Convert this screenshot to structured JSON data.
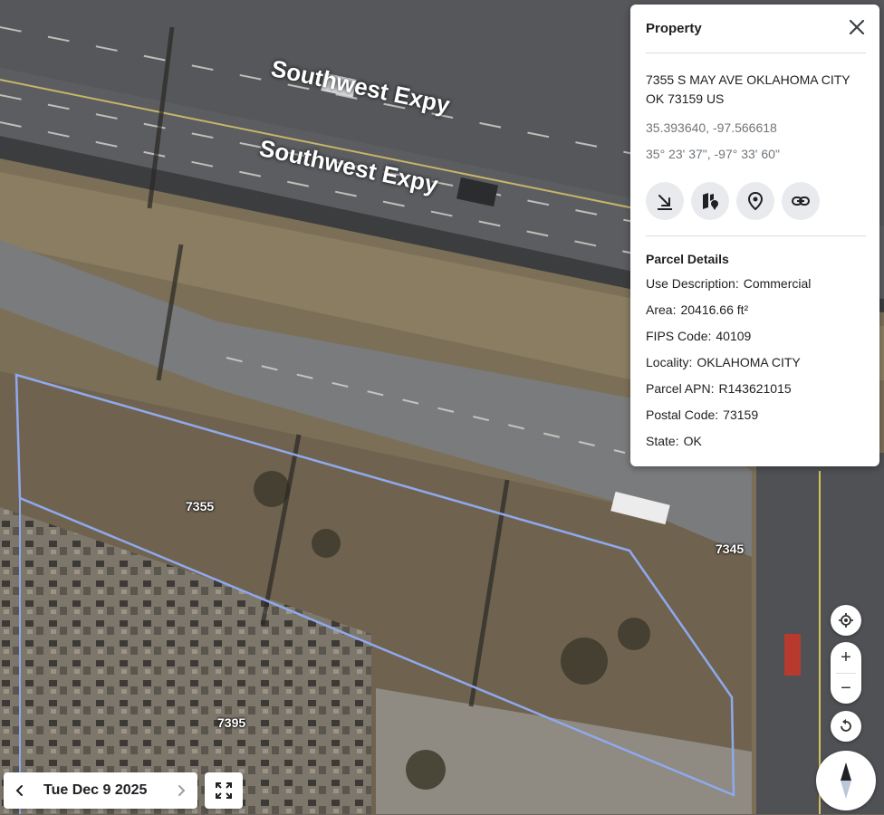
{
  "map": {
    "road_label_1": "Southwest Expy",
    "road_label_2": "Southwest Expy",
    "parcel_labels": {
      "p7355": "7355",
      "p7345": "7345",
      "p7395": "7395"
    }
  },
  "panel": {
    "title": "Property",
    "address": "7355 S MAY AVE OKLAHOMA CITY OK 73159 US",
    "coords_decimal": "35.393640, -97.566618",
    "coords_dms": "35° 23' 37\", -97° 33' 60\"",
    "actions": [
      "download-icon",
      "parcel-map-icon",
      "location-pin-icon",
      "link-icon"
    ],
    "details_title": "Parcel Details",
    "details": [
      {
        "key": "Use Description:",
        "value": "Commercial"
      },
      {
        "key": "Area:",
        "value": "20416.66 ft²"
      },
      {
        "key": "FIPS Code:",
        "value": "40109"
      },
      {
        "key": "Locality:",
        "value": "OKLAHOMA CITY"
      },
      {
        "key": "Parcel APN:",
        "value": "R143621015"
      },
      {
        "key": "Postal Code:",
        "value": "73159"
      },
      {
        "key": "State:",
        "value": "OK"
      }
    ]
  },
  "date_bar": {
    "label": "Tue Dec 9 2025"
  },
  "controls": {
    "zoom_in": "+",
    "zoom_out": "−"
  },
  "colors": {
    "parcel_outline": "#8fa9ee",
    "highway": "#4d4f52",
    "grass": "#8a7d62"
  }
}
